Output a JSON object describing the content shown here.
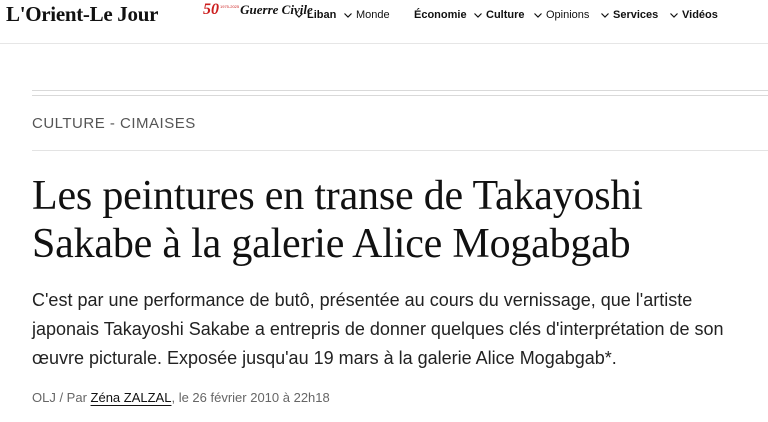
{
  "header": {
    "logo": "L'Orient-Le Jour",
    "badge": {
      "number": "50",
      "mini": "1975-2025",
      "text": "Guerre Civile"
    },
    "nav": [
      {
        "label": "Liban",
        "chevron": true,
        "bold": true
      },
      {
        "label": "Monde",
        "chevron": true,
        "bold": false
      },
      {
        "label": "Économie",
        "chevron": false,
        "bold": true
      },
      {
        "label": "Culture",
        "chevron": true,
        "bold": true
      },
      {
        "label": "Opinions",
        "chevron": true,
        "bold": false
      },
      {
        "label": "Services",
        "chevron": true,
        "bold": true
      },
      {
        "label": "Vidéos",
        "chevron": true,
        "bold": true
      }
    ]
  },
  "article": {
    "kicker": "CULTURE - CIMAISES",
    "title": "Les peintures en transe de Takayoshi Sakabe à la galerie Alice Mogabgab",
    "lede": "C'est par une performance de butô, présentée au cours du vernissage, que l'artiste japonais Takayoshi Sakabe a entrepris de donner quelques clés d'interprétation de son œuvre picturale. Exposée jusqu'au 19 mars à la galerie Alice Mogabgab*.",
    "byline": {
      "source": "OLJ / Par ",
      "author": "Zéna ZALZAL",
      "date": ", le 26 février 2010 à 22h18"
    }
  },
  "colors": {
    "badge_red": "#cc1f1f",
    "rule": "#d9d9d9",
    "text": "#111111"
  },
  "icons": {
    "nav_chevron": "chevron-down-icon"
  }
}
